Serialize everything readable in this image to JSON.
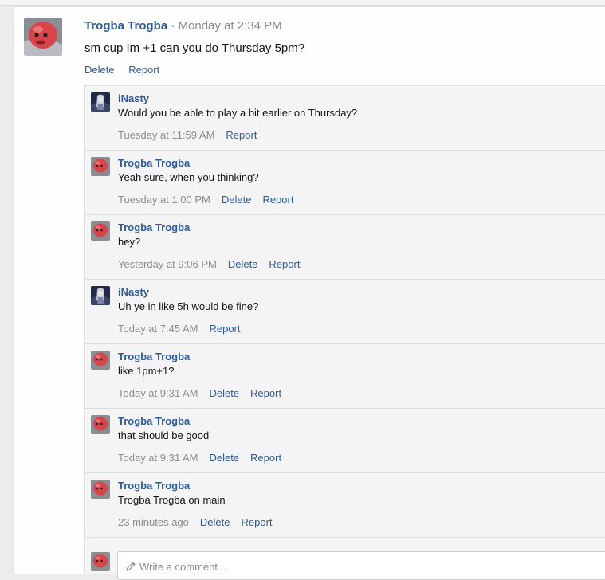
{
  "post": {
    "author": "Trogba Trogba",
    "separator": " · ",
    "date": "Monday at 2:34 PM",
    "text": "sm cup Im +1 can you do Thursday 5pm?",
    "actions": {
      "delete": "Delete",
      "report": "Report"
    }
  },
  "comments": [
    {
      "author": "iNasty",
      "avatar": "inasty-avatar",
      "text": "Would you be able to play a bit earlier on Thursday?",
      "time": "Tuesday at 11:59 AM",
      "actions": [
        "Report"
      ]
    },
    {
      "author": "Trogba Trogba",
      "avatar": "trogba-avatar",
      "text": "Yeah sure, when you thinking?",
      "time": "Tuesday at 1:00 PM",
      "actions": [
        "Delete",
        "Report"
      ]
    },
    {
      "author": "Trogba Trogba",
      "avatar": "trogba-avatar",
      "text": "hey?",
      "time": "Yesterday at 9:06 PM",
      "actions": [
        "Delete",
        "Report"
      ]
    },
    {
      "author": "iNasty",
      "avatar": "inasty-avatar",
      "text": "Uh ye in like 5h would be fine?",
      "time": "Today at 7:45 AM",
      "actions": [
        "Report"
      ]
    },
    {
      "author": "Trogba Trogba",
      "avatar": "trogba-avatar",
      "text": "like 1pm+1?",
      "time": "Today at 9:31 AM",
      "actions": [
        "Delete",
        "Report"
      ]
    },
    {
      "author": "Trogba Trogba",
      "avatar": "trogba-avatar",
      "text": "that should be good",
      "time": "Today at 9:31 AM",
      "actions": [
        "Delete",
        "Report"
      ]
    },
    {
      "author": "Trogba Trogba",
      "avatar": "trogba-avatar",
      "text": "Trogba Trogba on main",
      "time": "23 minutes ago",
      "actions": [
        "Delete",
        "Report"
      ]
    }
  ],
  "composer": {
    "placeholder": "Write a comment...",
    "icon": "pencil-icon"
  },
  "colors": {
    "link": "#2b5ca3",
    "muted": "#8c8c8c",
    "comment_bg": "#f4f4f4",
    "avatar_red": "#d9434a"
  }
}
